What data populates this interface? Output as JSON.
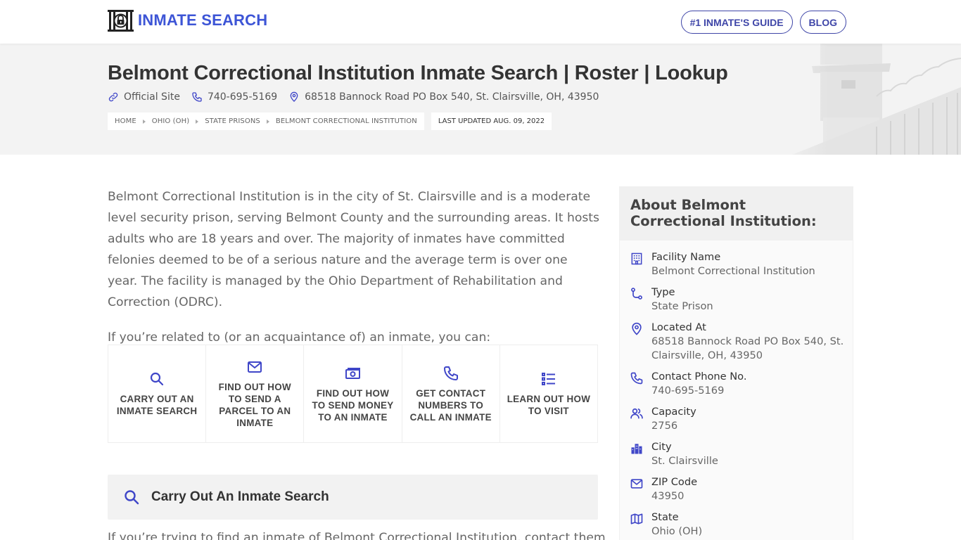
{
  "header": {
    "logo_text": "INMATE SEARCH",
    "nav": [
      {
        "label": "#1 INMATE'S GUIDE"
      },
      {
        "label": "BLOG"
      }
    ]
  },
  "hero": {
    "title": "Belmont Correctional Institution Inmate Search | Roster | Lookup",
    "official_site": "Official Site",
    "phone": "740-695-5169",
    "address": "68518 Bannock Road PO Box 540, St. Clairsville, OH, 43950",
    "breadcrumbs": [
      "HOME",
      "OHIO (OH)",
      "STATE PRISONS",
      "BELMONT CORRECTIONAL INSTITUTION"
    ],
    "last_updated": "LAST UPDATED AUG. 09, 2022"
  },
  "main": {
    "intro": "Belmont Correctional Institution is in the city of St. Clairsville and is a moderate level security prison, serving Belmont County and the surrounding areas. It hosts adults who are 18 years and over. The majority of inmates have committed felonies deemed to be of a serious nature and the average term is over one year. The facility is managed by the Ohio Department of Rehabilitation and Correction (ODRC).",
    "lead": "If you’re related to (or an acquaintance of) an inmate, you can:",
    "actions": [
      {
        "label": "CARRY OUT AN INMATE SEARCH",
        "icon": "search-icon"
      },
      {
        "label": "FIND OUT HOW TO SEND A PARCEL TO AN INMATE",
        "icon": "envelope-icon"
      },
      {
        "label": "FIND OUT HOW TO SEND MONEY TO AN INMATE",
        "icon": "money-icon"
      },
      {
        "label": "GET CONTACT NUMBERS TO CALL AN INMATE",
        "icon": "phone-icon"
      },
      {
        "label": "LEARN OUT HOW TO VISIT",
        "icon": "list-icon"
      }
    ],
    "section_title": "Carry Out An Inmate Search",
    "section_text": "If you’re trying to find an inmate of Belmont Correctional Institution, contact them"
  },
  "sidebar": {
    "title": "About Belmont Correctional Institution:",
    "facts": [
      {
        "label": "Facility Name",
        "value": "Belmont Correctional Institution",
        "icon": "building-icon"
      },
      {
        "label": "Type",
        "value": "State Prison",
        "icon": "route-icon"
      },
      {
        "label": "Located At",
        "value": "68518 Bannock Road PO Box 540, St. Clairsville, OH, 43950",
        "icon": "map-pin-icon"
      },
      {
        "label": "Contact Phone No.",
        "value": "740-695-5169",
        "icon": "phone-icon"
      },
      {
        "label": "Capacity",
        "value": "2756",
        "icon": "users-icon"
      },
      {
        "label": "City",
        "value": "St. Clairsville",
        "icon": "city-icon"
      },
      {
        "label": "ZIP Code",
        "value": "43950",
        "icon": "envelope-icon"
      },
      {
        "label": "State",
        "value": "Ohio (OH)",
        "icon": "map-icon"
      }
    ]
  },
  "colors": {
    "accent": "#3d55d6",
    "icon": "#3f46c8",
    "nav_border": "#3f46a8",
    "hero_bg": "#f3f3f3",
    "text": "#666666",
    "heading": "#333333"
  }
}
